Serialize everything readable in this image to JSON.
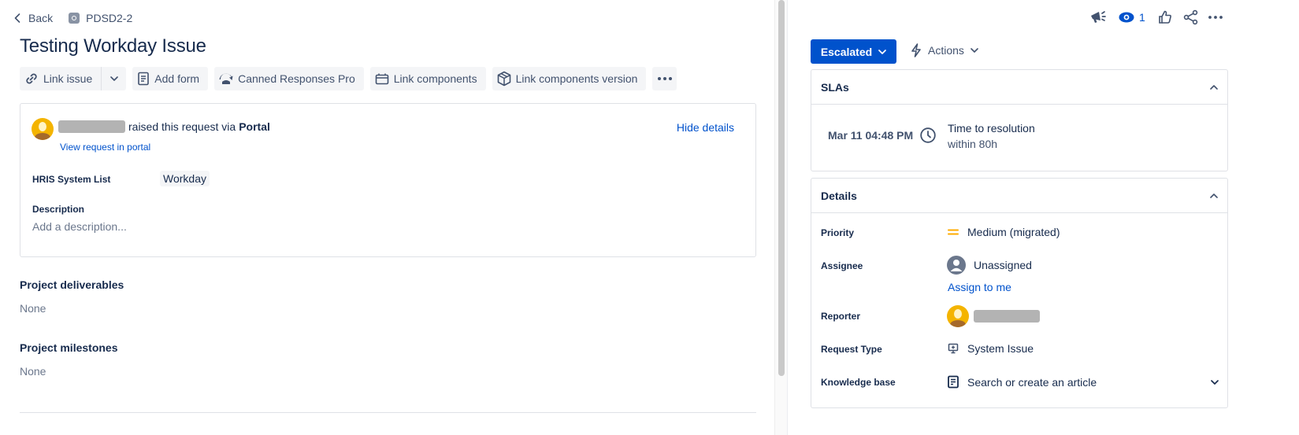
{
  "breadcrumb": {
    "back_label": "Back",
    "issue_key": "PDSD2-2"
  },
  "issue": {
    "title": "Testing Workday Issue"
  },
  "toolbar": {
    "link_issue": "Link issue",
    "add_form": "Add form",
    "canned_responses": "Canned Responses Pro",
    "link_components": "Link components",
    "link_components_version": "Link components version"
  },
  "request": {
    "raised_text": "raised this request via",
    "channel": "Portal",
    "view_portal": "View request in portal",
    "hide_details": "Hide details",
    "hris_label": "HRIS System List",
    "hris_value": "Workday",
    "description_label": "Description",
    "description_placeholder": "Add a description..."
  },
  "sections": {
    "deliverables_label": "Project deliverables",
    "deliverables_value": "None",
    "milestones_label": "Project milestones",
    "milestones_value": "None"
  },
  "header_icons": {
    "watch_count": "1"
  },
  "status": {
    "label": "Escalated",
    "actions_label": "Actions"
  },
  "slas": {
    "title": "SLAs",
    "date": "Mar 11 04:48 PM",
    "name": "Time to resolution",
    "subtext": "within 80h"
  },
  "details": {
    "title": "Details",
    "priority_label": "Priority",
    "priority_value": "Medium (migrated)",
    "priority_color": "#ffab00",
    "assignee_label": "Assignee",
    "assignee_value": "Unassigned",
    "assign_to_me": "Assign to me",
    "reporter_label": "Reporter",
    "request_type_label": "Request Type",
    "request_type_value": "System Issue",
    "kb_label": "Knowledge base",
    "kb_value": "Search or create an article"
  },
  "colors": {
    "primary": "#0052cc",
    "text": "#172b4d",
    "subtle": "#42526e",
    "border": "#dfe1e6"
  }
}
